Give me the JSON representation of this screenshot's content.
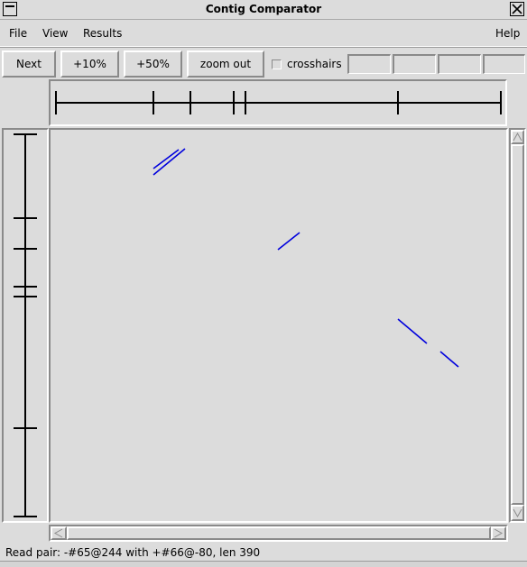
{
  "window": {
    "title": "Contig Comparator"
  },
  "menu": {
    "file": "File",
    "view": "View",
    "results": "Results",
    "help": "Help"
  },
  "toolbar": {
    "next": "Next",
    "zoom_10": "+10%",
    "zoom_50": "+50%",
    "zoom_out": "zoom out",
    "crosshairs_label": "crosshairs",
    "crosshairs_checked": false
  },
  "status": {
    "text": "Read pair: -#65@244 with +#66@-80, len 390"
  },
  "colors": {
    "alignment": "#0000dd",
    "background": "#dcdcdc"
  },
  "icons": [
    "window-menu-icon",
    "close-icon",
    "scroll-up-icon",
    "scroll-down-icon",
    "scroll-left-icon",
    "scroll-right-icon"
  ]
}
